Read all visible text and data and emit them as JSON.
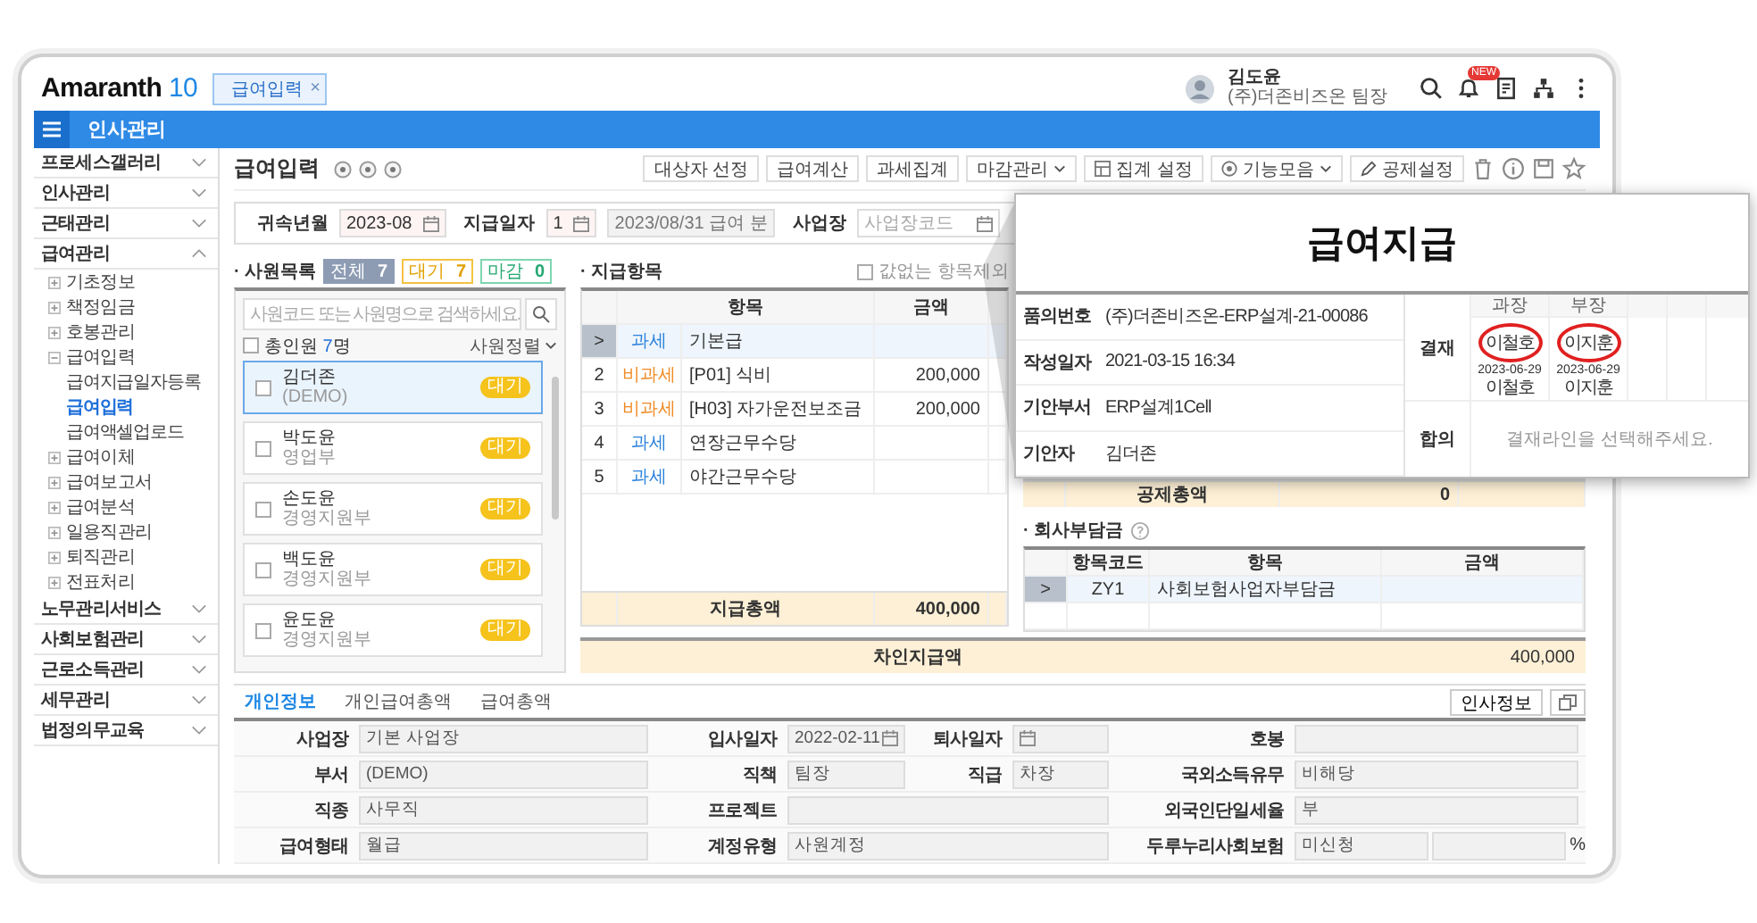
{
  "app": {
    "logo": {
      "name": "Amaranth",
      "version": "10"
    },
    "open_tab": {
      "label": "급여입력",
      "close": "×"
    }
  },
  "user": {
    "name": "김도윤",
    "company": "(주)더존비즈온 팀장",
    "badge": "NEW"
  },
  "module_bar": {
    "title": "인사관리"
  },
  "sidebar": {
    "items": [
      {
        "label": "프로세스갤러리",
        "expanded": false
      },
      {
        "label": "인사관리",
        "expanded": false
      },
      {
        "label": "근태관리",
        "expanded": false
      },
      {
        "label": "급여관리",
        "expanded": true,
        "children": [
          {
            "label": "기초정보",
            "expanded": false
          },
          {
            "label": "책정임금",
            "expanded": false
          },
          {
            "label": "호봉관리",
            "expanded": false
          },
          {
            "label": "급여입력",
            "expanded": true,
            "children": [
              {
                "label": "급여지급일자등록",
                "selected": false
              },
              {
                "label": "급여입력",
                "selected": true
              },
              {
                "label": "급여액셀업로드",
                "selected": false
              }
            ]
          },
          {
            "label": "급여이체",
            "expanded": false
          },
          {
            "label": "급여보고서",
            "expanded": false
          },
          {
            "label": "급여분석",
            "expanded": false
          },
          {
            "label": "일용직관리",
            "expanded": false
          },
          {
            "label": "퇴직관리",
            "expanded": false
          },
          {
            "label": "전표처리",
            "expanded": false
          }
        ]
      },
      {
        "label": "노무관리서비스",
        "expanded": false
      },
      {
        "label": "사회보험관리",
        "expanded": false
      },
      {
        "label": "근로소득관리",
        "expanded": false
      },
      {
        "label": "세무관리",
        "expanded": false
      },
      {
        "label": "법정의무교육",
        "expanded": false
      }
    ]
  },
  "page": {
    "title": "급여입력",
    "toolbar": [
      {
        "label": "대상자 선정",
        "kind": "text"
      },
      {
        "label": "급여계산",
        "kind": "text"
      },
      {
        "label": "과세집계",
        "kind": "text"
      },
      {
        "label": "마감관리",
        "kind": "menu"
      },
      {
        "label": "집계 설정",
        "kind": "table"
      },
      {
        "label": "기능모음",
        "kind": "apps"
      },
      {
        "label": "공제설정",
        "kind": "edit"
      }
    ]
  },
  "filters": [
    {
      "label": "귀속년월",
      "kind": "month",
      "value": "2023-08"
    },
    {
      "label": "지급일자",
      "kind": "pay-date",
      "value": "1",
      "note": "2023/08/31 급여 분"
    },
    {
      "label": "사업장",
      "kind": "code",
      "placeholder": "사업장코드"
    }
  ],
  "employees": {
    "title": "· 사원목록",
    "counts": [
      {
        "label": "전체",
        "count": "7",
        "kind": "all"
      },
      {
        "label": "대기",
        "count": "7",
        "kind": "waiting"
      },
      {
        "label": "마감",
        "count": "0",
        "kind": "closed"
      }
    ],
    "search_placeholder": "사원코드 또는 사원명으로 검색하세요.",
    "total": {
      "label": "총인원",
      "count": "7",
      "unit": "명",
      "checked": false
    },
    "sort": "사원정렬",
    "list": [
      {
        "name": "김더존",
        "dept": "(DEMO)",
        "status": "대기",
        "selected": true,
        "checked": false
      },
      {
        "name": "박도윤",
        "dept": "영업부",
        "status": "대기",
        "selected": false,
        "checked": false
      },
      {
        "name": "손도윤",
        "dept": "경영지원부",
        "status": "대기",
        "selected": false,
        "checked": false
      },
      {
        "name": "백도윤",
        "dept": "경영지원부",
        "status": "대기",
        "selected": false,
        "checked": false
      },
      {
        "name": "윤도윤",
        "dept": "경영지원부",
        "status": "대기",
        "selected": false,
        "checked": false
      }
    ]
  },
  "pay_items": {
    "title": "· 지급항목",
    "exclude_empty": {
      "label": "값없는 항목제외",
      "checked": false
    },
    "columns": [
      "항목",
      "금액"
    ],
    "current_marker": ">",
    "rows": [
      {
        "tax": "과세",
        "color": "#2b82dc",
        "name": "기본급",
        "selected": true
      },
      {
        "no": "2",
        "tax": "비과세",
        "color": "#f08a24",
        "name": "[P01] 식비",
        "amount": "200,000",
        "selected": false
      },
      {
        "no": "3",
        "tax": "비과세",
        "color": "#f08a24",
        "name": "[H03] 자가운전보조금",
        "amount": "200,000",
        "selected": false
      },
      {
        "no": "4",
        "tax": "과세",
        "color": "#2b82dc",
        "name": "연장근무수당",
        "selected": false
      },
      {
        "no": "5",
        "tax": "과세",
        "color": "#2b82dc",
        "name": "야간근무수당",
        "selected": false
      }
    ],
    "total_label": "지급총액",
    "total": "400,000"
  },
  "deductions": {
    "total_label": "공제총액",
    "total": "0"
  },
  "company_burden": {
    "title": "· 회사부담금",
    "columns": [
      "항목코드",
      "항목",
      "금액"
    ],
    "current_marker": ">",
    "rows": [
      {
        "code": "ZY1",
        "name": "사회보험사업자부담금",
        "selected": true
      }
    ]
  },
  "net_pay": {
    "label": "차인지급액",
    "value": "400,000"
  },
  "detail": {
    "tabs": [
      {
        "label": "개인정보",
        "selected": true
      },
      {
        "label": "개인급여총액",
        "selected": false
      },
      {
        "label": "급여총액",
        "selected": false
      }
    ],
    "button": "인사정보",
    "rows": [
      {
        "fields": [
          {
            "label": "사업장",
            "kind": "text",
            "value": "기본 사업장"
          },
          {
            "label": "입사일자",
            "kind": "date",
            "value": "2022-02-11"
          },
          {
            "label": "퇴사일자",
            "kind": "date"
          },
          {
            "label": "호봉",
            "kind": "text"
          }
        ]
      },
      {
        "fields": [
          {
            "label": "부서",
            "kind": "text",
            "value": "(DEMO)"
          },
          {
            "label": "직책",
            "kind": "text",
            "value": "팀장"
          },
          {
            "label": "직급",
            "kind": "text",
            "value": "차장"
          },
          {
            "label": "국외소득유무",
            "kind": "text",
            "value": "비해당"
          }
        ]
      },
      {
        "fields": [
          {
            "label": "직종",
            "kind": "text",
            "value": "사무직"
          },
          {
            "label": "프로젝트",
            "kind": "wide"
          },
          {
            "label": "외국인단일세율",
            "kind": "text",
            "value": "부"
          }
        ]
      },
      {
        "fields": [
          {
            "label": "급여형태",
            "kind": "text",
            "value": "월급"
          },
          {
            "label": "계정유형",
            "kind": "wide",
            "value": "사원계정"
          },
          {
            "label": "두루누리사회보험",
            "kind": "percent",
            "value": "미신청",
            "unit": "%"
          }
        ]
      }
    ]
  },
  "popup": {
    "title": "급여지급",
    "info": [
      {
        "label": "품의번호",
        "value": "(주)더존비즈온-ERP설계-21-00086"
      },
      {
        "label": "작성일자",
        "value": "2021-03-15 16:34"
      },
      {
        "label": "기안부서",
        "value": "ERP설계1Cell"
      },
      {
        "label": "기안자",
        "value": "김더존"
      }
    ],
    "approval": {
      "label": "결재",
      "signers": [
        {
          "title": "과장",
          "stamp": "이철호",
          "date": "2023-06-29",
          "name": "이철호"
        },
        {
          "title": "부장",
          "stamp": "이지훈",
          "date": "2023-06-29",
          "name": "이지훈"
        }
      ]
    },
    "agreement": {
      "label": "합의",
      "message": "결재라인을 선택해주세요."
    }
  }
}
